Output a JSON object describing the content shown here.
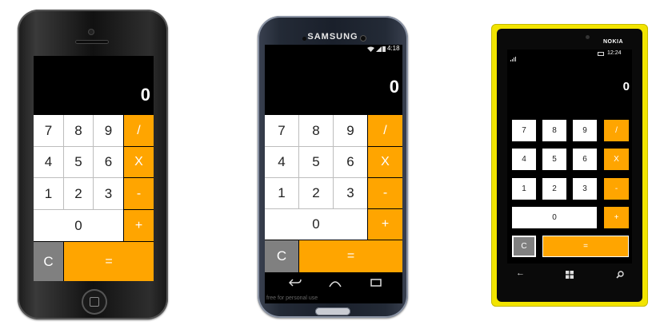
{
  "iphone": {
    "display_value": "0",
    "keys": {
      "seven": "7",
      "eight": "8",
      "nine": "9",
      "divide": "/",
      "four": "4",
      "five": "5",
      "six": "6",
      "multiply": "X",
      "one": "1",
      "two": "2",
      "three": "3",
      "minus": "-",
      "zero": "0",
      "plus": "+",
      "clear": "C",
      "equals": "="
    }
  },
  "samsung": {
    "brand": "SAMSUNG",
    "status_time": "4:18",
    "display_value": "0",
    "keys": {
      "seven": "7",
      "eight": "8",
      "nine": "9",
      "divide": "/",
      "four": "4",
      "five": "5",
      "six": "6",
      "multiply": "X",
      "one": "1",
      "two": "2",
      "three": "3",
      "minus": "-",
      "zero": "0",
      "plus": "+",
      "clear": "C",
      "equals": "="
    },
    "watermark": "free for personal use"
  },
  "nokia": {
    "brand": "NOKIA",
    "status_time": "12:24",
    "display_value": "0",
    "keys": {
      "seven": "7",
      "eight": "8",
      "nine": "9",
      "divide": "/",
      "four": "4",
      "five": "5",
      "six": "6",
      "multiply": "X",
      "one": "1",
      "two": "2",
      "three": "3",
      "minus": "-",
      "zero": "0",
      "plus": "+",
      "clear": "C",
      "equals": "="
    }
  },
  "colors": {
    "accent_orange": "#ffa500",
    "clear_gray": "#808080",
    "nokia_yellow": "#f2e400"
  }
}
